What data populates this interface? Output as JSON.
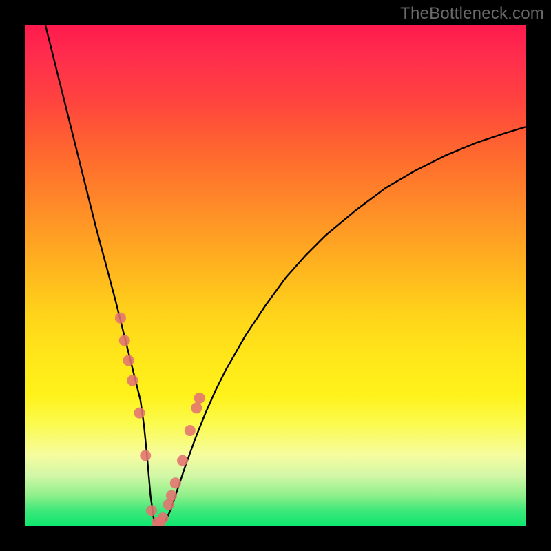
{
  "watermark": "TheBottleneck.com",
  "chart_data": {
    "type": "line",
    "title": "",
    "xlabel": "",
    "ylabel": "",
    "xlim": [
      0,
      100
    ],
    "ylim": [
      0,
      100
    ],
    "grid": false,
    "legend": false,
    "series": [
      {
        "name": "curve",
        "color": "#000000",
        "x": [
          4,
          6,
          8,
          10,
          12,
          14,
          16,
          18,
          20,
          21,
          22,
          23,
          23.7,
          24.3,
          25,
          25.7,
          26.4,
          27,
          28,
          29,
          30,
          32,
          34,
          36,
          38,
          40,
          44,
          48,
          52,
          56,
          60,
          66,
          72,
          78,
          84,
          90,
          96,
          100
        ],
        "y": [
          100,
          92,
          84,
          76,
          68,
          60,
          52.5,
          45,
          37,
          33,
          29,
          25,
          20,
          14,
          6,
          1,
          0.5,
          0.5,
          1,
          3,
          6,
          12,
          17.5,
          22.5,
          27,
          31,
          38,
          44,
          49.5,
          54,
          58,
          63,
          67.5,
          71,
          74,
          76.5,
          78.5,
          79.7
        ]
      },
      {
        "name": "dots",
        "type": "scatter",
        "color": "#e2736f",
        "radius": 8,
        "x": [
          19.0,
          19.8,
          20.6,
          21.4,
          22.8,
          24.0,
          25.2,
          26.3,
          26.9,
          27.5,
          28.6,
          29.2,
          30.0,
          31.4,
          32.9,
          34.2,
          34.8
        ],
        "y": [
          41.5,
          37.0,
          33.0,
          29.0,
          22.5,
          14.0,
          3.0,
          0.6,
          0.6,
          1.5,
          4.2,
          6.0,
          8.5,
          13.0,
          19.0,
          23.5,
          25.5
        ]
      }
    ],
    "background_gradient": {
      "direction": "vertical",
      "stops": [
        {
          "pos": 0.0,
          "color": "#ff1a4d"
        },
        {
          "pos": 0.26,
          "color": "#ff6a2e"
        },
        {
          "pos": 0.58,
          "color": "#ffd41a"
        },
        {
          "pos": 0.8,
          "color": "#fbfb52"
        },
        {
          "pos": 0.94,
          "color": "#8ff08a"
        },
        {
          "pos": 1.0,
          "color": "#11e76f"
        }
      ]
    }
  }
}
